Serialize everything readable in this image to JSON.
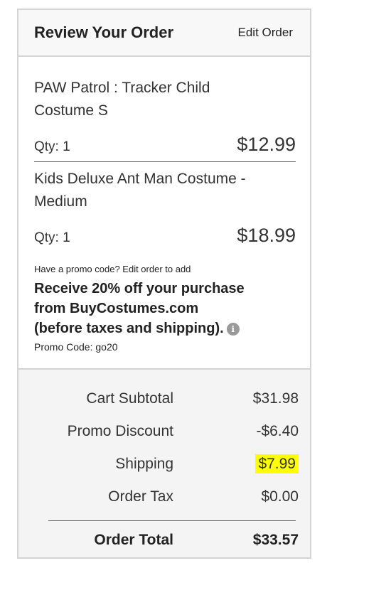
{
  "header": {
    "title": "Review Your Order",
    "edit_label": "Edit Order"
  },
  "items": [
    {
      "name_line1": "PAW Patrol : Tracker Child",
      "name_line2": "Costume S",
      "qty": "Qty: 1",
      "price": "$12.99"
    },
    {
      "name_line1": "Kids Deluxe Ant Man Costume -",
      "name_line2": "Medium",
      "qty": "Qty: 1",
      "price": "$18.99"
    }
  ],
  "promo": {
    "hint": "Have a promo code? Edit order to add",
    "offer_line1": "Receive 20% off your purchase",
    "offer_line2": "from BuyCostumes.com",
    "offer_line3": "(before taxes and shipping).",
    "code": "Promo Code: go20",
    "icon": "info-icon"
  },
  "totals": {
    "subtotal_label": "Cart Subtotal",
    "subtotal_value": "$31.98",
    "discount_label": "Promo Discount",
    "discount_value": "-$6.40",
    "shipping_label": "Shipping",
    "shipping_value": "$7.99",
    "tax_label": "Order Tax",
    "tax_value": "$0.00",
    "order_total_label": "Order Total",
    "order_total_value": "$33.57"
  },
  "colors": {
    "highlight": "#ffff00",
    "border": "#d4d4d4",
    "totals_bg": "#f4f4f4"
  }
}
